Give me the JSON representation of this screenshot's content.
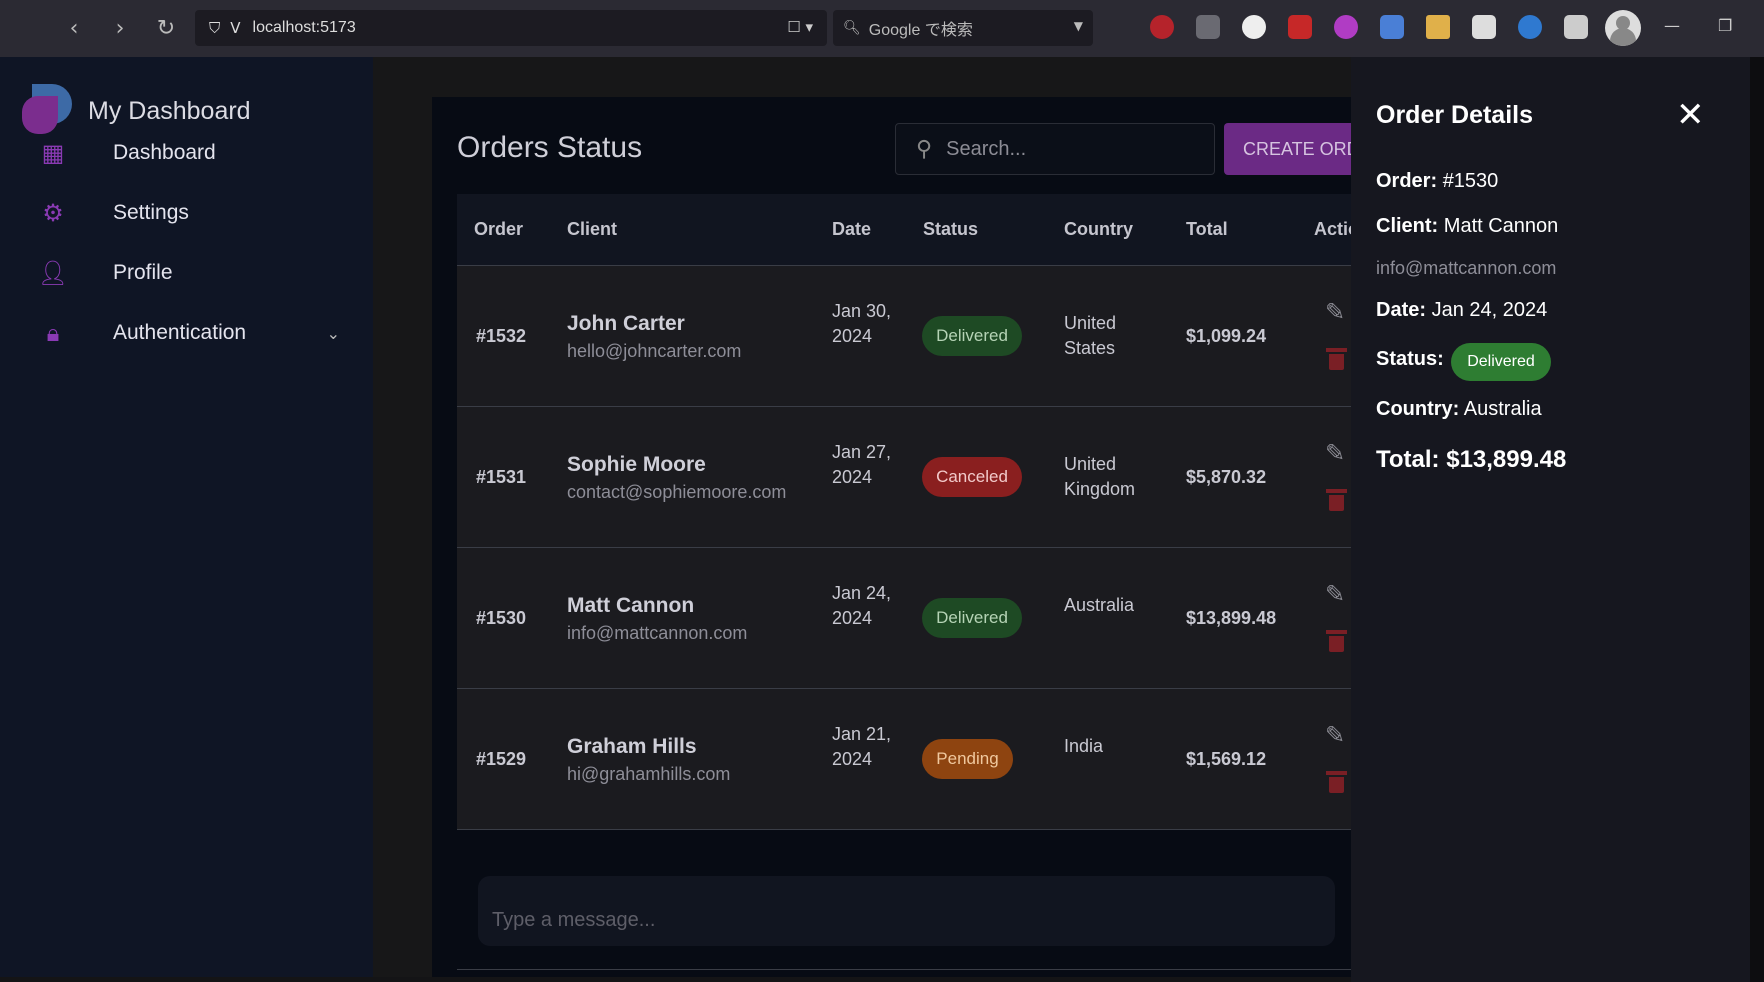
{
  "browser": {
    "url": "localhost:5173",
    "search_placeholder": "Google で検索"
  },
  "sidebar": {
    "brand": "My Dashboard",
    "items": [
      {
        "label": "Dashboard",
        "icon": "dashboard-icon"
      },
      {
        "label": "Settings",
        "icon": "gear-icon"
      },
      {
        "label": "Profile",
        "icon": "person-icon"
      },
      {
        "label": "Authentication",
        "icon": "lock-icon"
      }
    ]
  },
  "main": {
    "title": "Orders Status",
    "search_placeholder": "Search...",
    "create_button": "CREATE ORDER",
    "columns": [
      "Order",
      "Client",
      "Date",
      "Status",
      "Country",
      "Total",
      "Actions"
    ],
    "orders": [
      {
        "order": "#1532",
        "name": "John Carter",
        "email": "hello@johncarter.com",
        "date": "Jan 30, 2024",
        "status": "Delivered",
        "country": "United States",
        "total": "$1,099.24"
      },
      {
        "order": "#1531",
        "name": "Sophie Moore",
        "email": "contact@sophiemoore.com",
        "date": "Jan 27, 2024",
        "status": "Canceled",
        "country": "United Kingdom",
        "total": "$5,870.32"
      },
      {
        "order": "#1530",
        "name": "Matt Cannon",
        "email": "info@mattcannon.com",
        "date": "Jan 24, 2024",
        "status": "Delivered",
        "country": "Australia",
        "total": "$13,899.48"
      },
      {
        "order": "#1529",
        "name": "Graham Hills",
        "email": "hi@grahamhills.com",
        "date": "Jan 21, 2024",
        "status": "Pending",
        "country": "India",
        "total": "$1,569.12"
      }
    ],
    "chat_placeholder": "Type a message..."
  },
  "drawer": {
    "title": "Order Details",
    "order_label": "Order:",
    "order_value": "#1530",
    "client_label": "Client:",
    "client_value": "Matt Cannon",
    "email": "info@mattcannon.com",
    "date_label": "Date:",
    "date_value": "Jan 24, 2024",
    "status_label": "Status:",
    "status_value": "Delivered",
    "country_label": "Country:",
    "country_value": "Australia",
    "total_label": "Total:",
    "total_value": "$13,899.48"
  },
  "colors": {
    "accent": "#7b2d8e",
    "delivered": "#1e4a24",
    "canceled": "#8a1f1f",
    "pending": "#8e4410"
  }
}
